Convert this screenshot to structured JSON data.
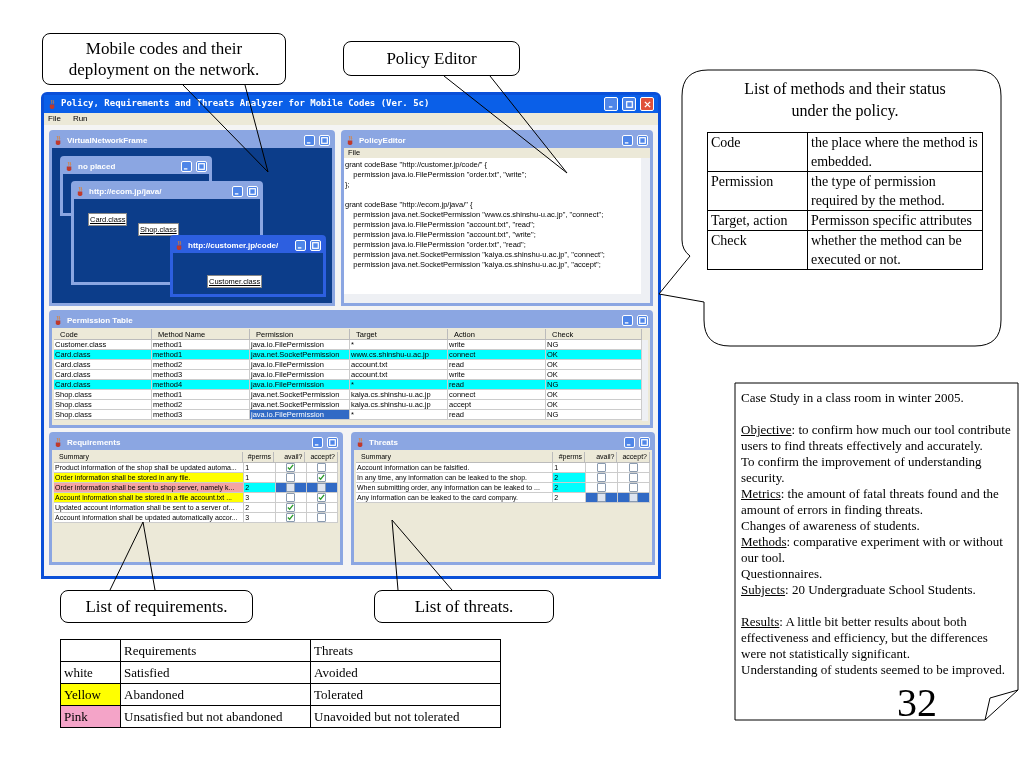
{
  "callouts": [
    {
      "text": "Mobile codes and their deployment on the network."
    },
    {
      "text": "Policy Editor"
    },
    {
      "text": "List of requirements."
    },
    {
      "text": "List of threats."
    }
  ],
  "window": {
    "title": "Policy, Requirements and Threats Analyzer for Mobile Codes (Ver. 5c)",
    "menu": [
      "File",
      "Run"
    ]
  },
  "network_frame": {
    "title": "VirtualNetworkFrame",
    "windows": [
      {
        "title": "no placed",
        "selected": false
      },
      {
        "title": "http://ecom.jp/java/",
        "selected": false,
        "classes": [
          "Card.class",
          "Shop.class"
        ]
      },
      {
        "title": "http://customer.jp/code/",
        "selected": true,
        "classes": [
          "Customer.class"
        ]
      }
    ]
  },
  "policy_editor": {
    "title": "PolicyEditor",
    "menu": [
      "File"
    ],
    "blocks": [
      [
        "grant codeBase \"http://customer.jp/code/\" {",
        "    permission java.io.FilePermission \"order.txt\", \"write\";",
        "};"
      ],
      [
        "grant codeBase \"http://ecom.jp/java/\" {",
        "    permission java.net.SocketPermission \"www.cs.shinshu-u.ac.jp\", \"connect\";",
        "    permission java.io.FilePermission \"account.txt\", \"read\";",
        "    permission java.io.FilePermission \"account.txt\", \"write\";",
        "    permission java.io.FilePermission \"order.txt\", \"read\";",
        "    permission java.net.SocketPermission \"kaiya.cs.shinshu-u.ac.jp\", \"connect\";",
        "    permission java.net.SocketPermission \"kaiya.cs.shinshu-u.ac.jp\", \"accept\";"
      ]
    ]
  },
  "permission_table": {
    "title": "Permission Table",
    "columns": [
      "Code",
      "Method Name",
      "Permission",
      "Target",
      "Action",
      "Check"
    ],
    "rows": [
      {
        "cells": [
          "Customer.class",
          "method1",
          "java.io.FilePermission",
          "*",
          "write",
          "NG"
        ],
        "highlighted": false,
        "selected": false
      },
      {
        "cells": [
          "Card.class",
          "method1",
          "java.net.SocketPermission",
          "www.cs.shinshu-u.ac.jp",
          "connect",
          "OK"
        ],
        "highlighted": true,
        "selected": false
      },
      {
        "cells": [
          "Card.class",
          "method2",
          "java.io.FilePermission",
          "account.txt",
          "read",
          "OK"
        ],
        "highlighted": false,
        "selected": false
      },
      {
        "cells": [
          "Card.class",
          "method3",
          "java.io.FilePermission",
          "account.txt",
          "write",
          "OK"
        ],
        "highlighted": false,
        "selected": false
      },
      {
        "cells": [
          "Card.class",
          "method4",
          "java.io.FilePermission",
          "*",
          "read",
          "NG"
        ],
        "highlighted": true,
        "selected": false
      },
      {
        "cells": [
          "Shop.class",
          "method1",
          "java.net.SocketPermission",
          "kaiya.cs.shinshu-u.ac.jp",
          "connect",
          "OK"
        ],
        "highlighted": false,
        "selected": false
      },
      {
        "cells": [
          "Shop.class",
          "method2",
          "java.net.SocketPermission",
          "kaiya.cs.shinshu-u.ac.jp",
          "accept",
          "OK"
        ],
        "highlighted": false,
        "selected": false
      },
      {
        "cells": [
          "Shop.class",
          "method3",
          "java.io.FilePermission",
          "*",
          "read",
          "NG"
        ],
        "highlighted": false,
        "selected": true
      }
    ]
  },
  "requirements": {
    "title": "Requirements",
    "columns": [
      "Summary",
      "#perms",
      "avail?",
      "accept?"
    ],
    "rows": [
      {
        "summary": "Product information of the shop shall be updated automa...",
        "perms": "1",
        "avail": true,
        "accept": false,
        "color": "#ffffff",
        "flagged": false,
        "selected": false
      },
      {
        "summary": "Order information shall be stored in any file.",
        "perms": "1",
        "avail": false,
        "accept": true,
        "color": "#ffff00",
        "flagged": false,
        "selected": false
      },
      {
        "summary": "Order information shall be sent to shop server, namely k...",
        "perms": "2",
        "avail": false,
        "accept": false,
        "color": "#f4a4a4",
        "flagged": true,
        "selected": true
      },
      {
        "summary": "Account information shall be stored in a file account.txt ...",
        "perms": "3",
        "avail": false,
        "accept": true,
        "color": "#ffff00",
        "flagged": false,
        "selected": false
      },
      {
        "summary": "Updated account information shall be sent to a server of...",
        "perms": "2",
        "avail": true,
        "accept": false,
        "color": "#ffffff",
        "flagged": false,
        "selected": false
      },
      {
        "summary": "Account information shall be updated automatically accor...",
        "perms": "3",
        "avail": true,
        "accept": false,
        "color": "#ffffff",
        "flagged": false,
        "selected": false
      }
    ]
  },
  "threats": {
    "title": "Threats",
    "columns": [
      "Summary",
      "#perms",
      "avail?",
      "accept?"
    ],
    "rows": [
      {
        "summary": "Account information can be falsified.",
        "perms": "1",
        "avail": false,
        "accept": false,
        "color": "#ffffff",
        "flagged": false,
        "selected": false
      },
      {
        "summary": "In any time, any information can be leaked to the shop.",
        "perms": "2",
        "avail": false,
        "accept": false,
        "color": "#ffffff",
        "flagged": true,
        "selected": false
      },
      {
        "summary": "When submitting order, any information can be leaked to ...",
        "perms": "2",
        "avail": false,
        "accept": false,
        "color": "#ffffff",
        "flagged": true,
        "selected": false
      },
      {
        "summary": "Any information can be leaked to the card company.",
        "perms": "2",
        "avail": false,
        "accept": false,
        "color": "#ffffff",
        "flagged": false,
        "selected": true
      }
    ]
  },
  "methods_bubble": {
    "title": "List of methods and their status under the policy.",
    "rows": [
      {
        "term": "Code",
        "description": "the place where the method is embedded."
      },
      {
        "term": "Permission",
        "description": "the type of permission required by the method."
      },
      {
        "term": "Target, action",
        "description": "Permisson specific attributes"
      },
      {
        "term": "Check",
        "description": "whether the method can be executed or not."
      }
    ]
  },
  "case_study": {
    "paragraphs": [
      [
        {
          "text": "Case Study in a class room in winter 2005."
        }
      ],
      [
        {
          "lead": "Objective",
          "text": ": to confirm how much our tool contribute users to find threats effectively and accurately."
        },
        {
          "text": "To confirm the improvement of understanding security."
        },
        {
          "lead": "Metrics",
          "text": ": the amount of fatal threats found and the amount of errors in finding threats."
        },
        {
          "text": "Changes of awareness of students."
        },
        {
          "lead": "Methods",
          "text": ": comparative experiment with or without our tool."
        },
        {
          "text": "Questionnaires."
        },
        {
          "lead": "Subjects",
          "text": ": 20 Undergraduate School Students."
        }
      ],
      [
        {
          "lead": "Results",
          "text": ": A little bit better results about both effectiveness and efficiency, but the differences were not statistically significant."
        },
        {
          "text": "Understanding of students seemed to be improved."
        }
      ]
    ]
  },
  "legend": {
    "columns": [
      "Requirements",
      "Threats"
    ],
    "rows": [
      {
        "label": "white",
        "color": "#ffffff",
        "requirements": "Satisfied",
        "threats": "Avoided"
      },
      {
        "label": "Yellow",
        "color": "#ffff00",
        "requirements": "Abandoned",
        "threats": "Tolerated"
      },
      {
        "label": "Pink",
        "color": "#f4a4c8",
        "requirements": "Unsatisfied but not abandoned",
        "threats": "Unavoided but not tolerated"
      }
    ]
  },
  "page_number": "32"
}
